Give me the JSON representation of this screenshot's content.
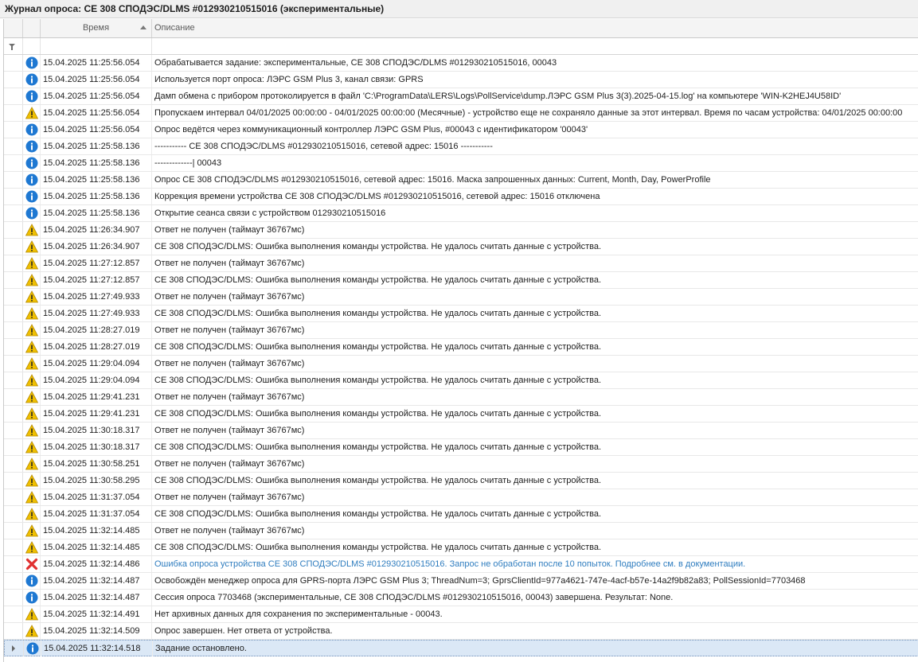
{
  "window": {
    "title": "Журнал опроса: CE 308 СПОДЭС/DLMS #012930210515016 (экспериментальные)"
  },
  "columns": {
    "time": "Время",
    "description": "Описание"
  },
  "colors": {
    "info": "#1e78d2",
    "warning": "#f0c000",
    "error": "#e03030",
    "error_text": "#2f7dbf",
    "selection": "#dbe8f6"
  },
  "rows": [
    {
      "type": "info",
      "icon": "info-icon",
      "time": "15.04.2025 11:25:56.054",
      "text": "Обрабатывается задание: экспериментальные, CE 308 СПОДЭС/DLMS #012930210515016, 00043"
    },
    {
      "type": "info",
      "icon": "info-icon",
      "time": "15.04.2025 11:25:56.054",
      "text": "Используется порт опроса: ЛЭРС GSM Plus 3, канал связи: GPRS"
    },
    {
      "type": "info",
      "icon": "info-icon",
      "time": "15.04.2025 11:25:56.054",
      "text": "Дамп обмена с прибором протоколируется в файл 'C:\\ProgramData\\LERS\\Logs\\PollService\\dump.ЛЭРС GSM Plus 3(3).2025-04-15.log' на компьютере 'WIN-K2HEJ4U58ID'"
    },
    {
      "type": "warning",
      "icon": "warning-icon",
      "time": "15.04.2025 11:25:56.054",
      "text": "Пропускаем интервал 04/01/2025 00:00:00 - 04/01/2025 00:00:00 (Месячные) - устройство еще не сохраняло данные за этот интервал. Время по часам устройства: 04/01/2025 00:00:00"
    },
    {
      "type": "info",
      "icon": "info-icon",
      "time": "15.04.2025 11:25:56.054",
      "text": "Опрос ведётся через коммуникационный контроллер ЛЭРС GSM Plus, #00043 с идентификатором '00043'"
    },
    {
      "type": "info",
      "icon": "info-icon",
      "time": "15.04.2025 11:25:58.136",
      "text": "----------- CE 308 СПОДЭС/DLMS #012930210515016, сетевой адрес: 15016 -----------"
    },
    {
      "type": "info",
      "icon": "info-icon",
      "time": "15.04.2025 11:25:58.136",
      "text": "-------------| 00043"
    },
    {
      "type": "info",
      "icon": "info-icon",
      "time": "15.04.2025 11:25:58.136",
      "text": "Опрос CE 308 СПОДЭС/DLMS #012930210515016, сетевой адрес: 15016. Маска запрошенных данных: Current, Month, Day, PowerProfile"
    },
    {
      "type": "info",
      "icon": "info-icon",
      "time": "15.04.2025 11:25:58.136",
      "text": "Коррекция времени устройства CE 308 СПОДЭС/DLMS #012930210515016, сетевой адрес: 15016 отключена"
    },
    {
      "type": "info",
      "icon": "info-icon",
      "time": "15.04.2025 11:25:58.136",
      "text": "Открытие сеанса связи с устройством 012930210515016"
    },
    {
      "type": "warning",
      "icon": "warning-icon",
      "time": "15.04.2025 11:26:34.907",
      "text": "Ответ не получен (таймаут 36767мс)"
    },
    {
      "type": "warning",
      "icon": "warning-icon",
      "time": "15.04.2025 11:26:34.907",
      "text": "CE 308 СПОДЭС/DLMS: Ошибка выполнения команды устройства. Не удалось считать данные с устройства."
    },
    {
      "type": "warning",
      "icon": "warning-icon",
      "time": "15.04.2025 11:27:12.857",
      "text": "Ответ не получен (таймаут 36767мс)"
    },
    {
      "type": "warning",
      "icon": "warning-icon",
      "time": "15.04.2025 11:27:12.857",
      "text": "CE 308 СПОДЭС/DLMS: Ошибка выполнения команды устройства. Не удалось считать данные с устройства."
    },
    {
      "type": "warning",
      "icon": "warning-icon",
      "time": "15.04.2025 11:27:49.933",
      "text": "Ответ не получен (таймаут 36767мс)"
    },
    {
      "type": "warning",
      "icon": "warning-icon",
      "time": "15.04.2025 11:27:49.933",
      "text": "CE 308 СПОДЭС/DLMS: Ошибка выполнения команды устройства. Не удалось считать данные с устройства."
    },
    {
      "type": "warning",
      "icon": "warning-icon",
      "time": "15.04.2025 11:28:27.019",
      "text": "Ответ не получен (таймаут 36767мс)"
    },
    {
      "type": "warning",
      "icon": "warning-icon",
      "time": "15.04.2025 11:28:27.019",
      "text": "CE 308 СПОДЭС/DLMS: Ошибка выполнения команды устройства. Не удалось считать данные с устройства."
    },
    {
      "type": "warning",
      "icon": "warning-icon",
      "time": "15.04.2025 11:29:04.094",
      "text": "Ответ не получен (таймаут 36767мс)"
    },
    {
      "type": "warning",
      "icon": "warning-icon",
      "time": "15.04.2025 11:29:04.094",
      "text": "CE 308 СПОДЭС/DLMS: Ошибка выполнения команды устройства. Не удалось считать данные с устройства."
    },
    {
      "type": "warning",
      "icon": "warning-icon",
      "time": "15.04.2025 11:29:41.231",
      "text": "Ответ не получен (таймаут 36767мс)"
    },
    {
      "type": "warning",
      "icon": "warning-icon",
      "time": "15.04.2025 11:29:41.231",
      "text": "CE 308 СПОДЭС/DLMS: Ошибка выполнения команды устройства. Не удалось считать данные с устройства."
    },
    {
      "type": "warning",
      "icon": "warning-icon",
      "time": "15.04.2025 11:30:18.317",
      "text": "Ответ не получен (таймаут 36767мс)"
    },
    {
      "type": "warning",
      "icon": "warning-icon",
      "time": "15.04.2025 11:30:18.317",
      "text": "CE 308 СПОДЭС/DLMS: Ошибка выполнения команды устройства. Не удалось считать данные с устройства."
    },
    {
      "type": "warning",
      "icon": "warning-icon",
      "time": "15.04.2025 11:30:58.251",
      "text": "Ответ не получен (таймаут 36767мс)"
    },
    {
      "type": "warning",
      "icon": "warning-icon",
      "time": "15.04.2025 11:30:58.295",
      "text": "CE 308 СПОДЭС/DLMS: Ошибка выполнения команды устройства. Не удалось считать данные с устройства."
    },
    {
      "type": "warning",
      "icon": "warning-icon",
      "time": "15.04.2025 11:31:37.054",
      "text": "Ответ не получен (таймаут 36767мс)"
    },
    {
      "type": "warning",
      "icon": "warning-icon",
      "time": "15.04.2025 11:31:37.054",
      "text": "CE 308 СПОДЭС/DLMS: Ошибка выполнения команды устройства. Не удалось считать данные с устройства."
    },
    {
      "type": "warning",
      "icon": "warning-icon",
      "time": "15.04.2025 11:32:14.485",
      "text": "Ответ не получен (таймаут 36767мс)"
    },
    {
      "type": "warning",
      "icon": "warning-icon",
      "time": "15.04.2025 11:32:14.485",
      "text": "CE 308 СПОДЭС/DLMS: Ошибка выполнения команды устройства. Не удалось считать данные с устройства."
    },
    {
      "type": "error",
      "icon": "error-icon",
      "time": "15.04.2025 11:32:14.486",
      "text": "Ошибка опроса устройства CE 308 СПОДЭС/DLMS #012930210515016. Запрос не обработан после 10 попыток. Подробнее см. в документации."
    },
    {
      "type": "info",
      "icon": "info-icon",
      "time": "15.04.2025 11:32:14.487",
      "text": "Освобождён менеджер опроса для GPRS-порта ЛЭРС GSM Plus 3; ThreadNum=3; GprsClientId=977a4621-747e-4acf-b57e-14a2f9b82a83; PollSessionId=7703468"
    },
    {
      "type": "info",
      "icon": "info-icon",
      "time": "15.04.2025 11:32:14.487",
      "text": "Сессия опроса 7703468 (экспериментальные, CE 308 СПОДЭС/DLMS #012930210515016, 00043) завершена. Результат: None."
    },
    {
      "type": "warning",
      "icon": "warning-icon",
      "time": "15.04.2025 11:32:14.491",
      "text": "Нет архивных данных для сохранения по экспериментальные - 00043."
    },
    {
      "type": "warning",
      "icon": "warning-icon",
      "time": "15.04.2025 11:32:14.509",
      "text": "Опрос завершен. Нет ответа от устройства."
    },
    {
      "type": "info",
      "icon": "info-icon",
      "time": "15.04.2025 11:32:14.518",
      "text": "Задание остановлено.",
      "selected": true
    }
  ]
}
